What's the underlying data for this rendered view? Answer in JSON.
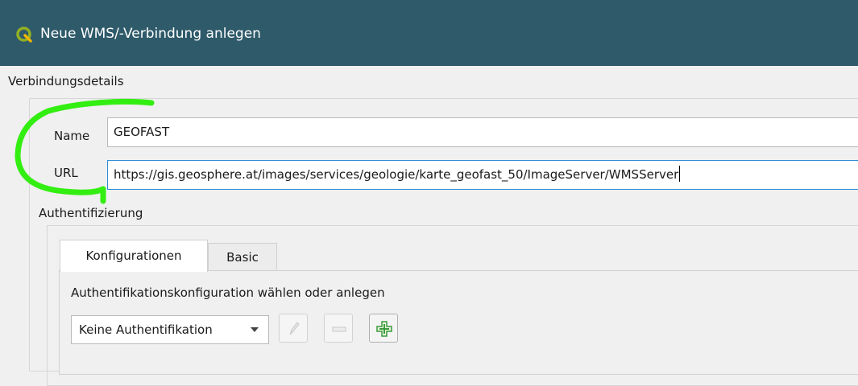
{
  "window": {
    "title": "Neue WMS/-Verbindung anlegen",
    "app_icon": "qgis-icon"
  },
  "connection": {
    "group_title": "Verbindungsdetails",
    "name_label": "Name",
    "name_value": "GEOFAST",
    "url_label": "URL",
    "url_value": "https://gis.geosphere.at/images/services/geologie/karte_geofast_50/ImageServer/WMSServer"
  },
  "auth": {
    "group_title": "Authentifizierung",
    "tabs": [
      {
        "label": "Konfigurationen",
        "active": true
      },
      {
        "label": "Basic",
        "active": false
      }
    ],
    "select_label": "Authentifikationskonfiguration wählen oder anlegen",
    "combo_value": "Keine Authentifikation",
    "buttons": [
      "edit-icon",
      "remove-icon",
      "add-icon"
    ]
  },
  "colors": {
    "titlebar": "#2e5a6a",
    "focus_border": "#2f8dd6",
    "highlight": "#33ee11",
    "add_icon": "#3a9a3a"
  }
}
